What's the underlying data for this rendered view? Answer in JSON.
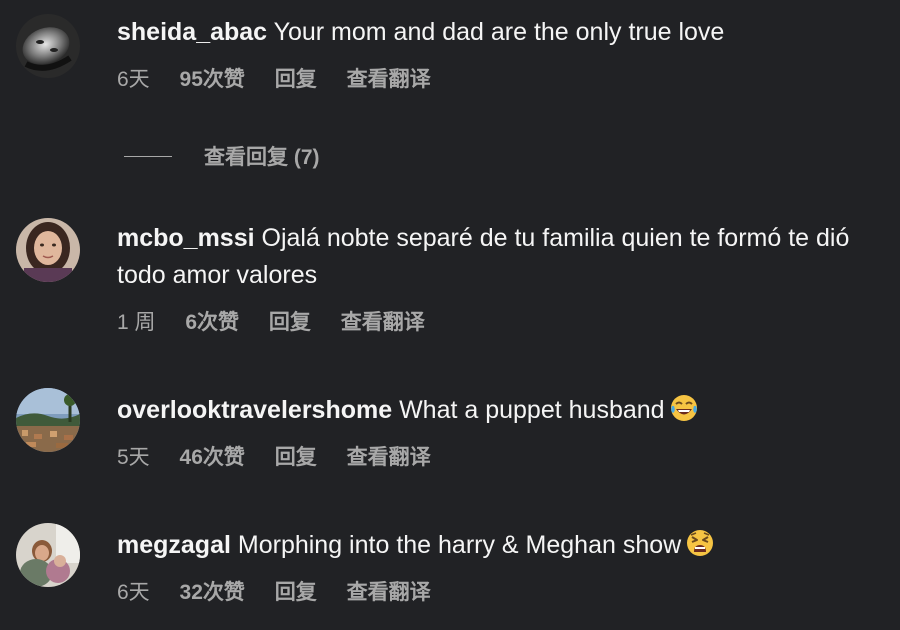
{
  "comments": [
    {
      "username": "sheida_abac",
      "text": "Your mom and dad are the only true love",
      "time": "6天",
      "likes": "95次赞",
      "reply": "回复",
      "translate": "查看翻译",
      "avatar": "avatar-sheida-abac"
    },
    {
      "username": "mcbo_mssi",
      "text": "Ojalá nobte separé de tu familia quien te formó te dió todo amor valores",
      "time": "1 周",
      "likes": "6次赞",
      "reply": "回复",
      "translate": "查看翻译",
      "avatar": "avatar-mcbo-mssi"
    },
    {
      "username": "overlooktravelershome",
      "text": "What a puppet husband",
      "emoji": "tears-of-joy-emoji",
      "time": "5天",
      "likes": "46次赞",
      "reply": "回复",
      "translate": "查看翻译",
      "avatar": "avatar-overlooktravelershome"
    },
    {
      "username": "megzagal",
      "text": "Morphing into the harry & Meghan show",
      "emoji": "tired-face-emoji",
      "time": "6天",
      "likes": "32次赞",
      "reply": "回复",
      "translate": "查看翻译",
      "avatar": "avatar-megzagal"
    }
  ],
  "view_replies": {
    "label": "查看回复 (7)"
  },
  "colors": {
    "background": "#212225",
    "primary_text": "#f5f5f5",
    "secondary_text": "#a8a8a8"
  }
}
